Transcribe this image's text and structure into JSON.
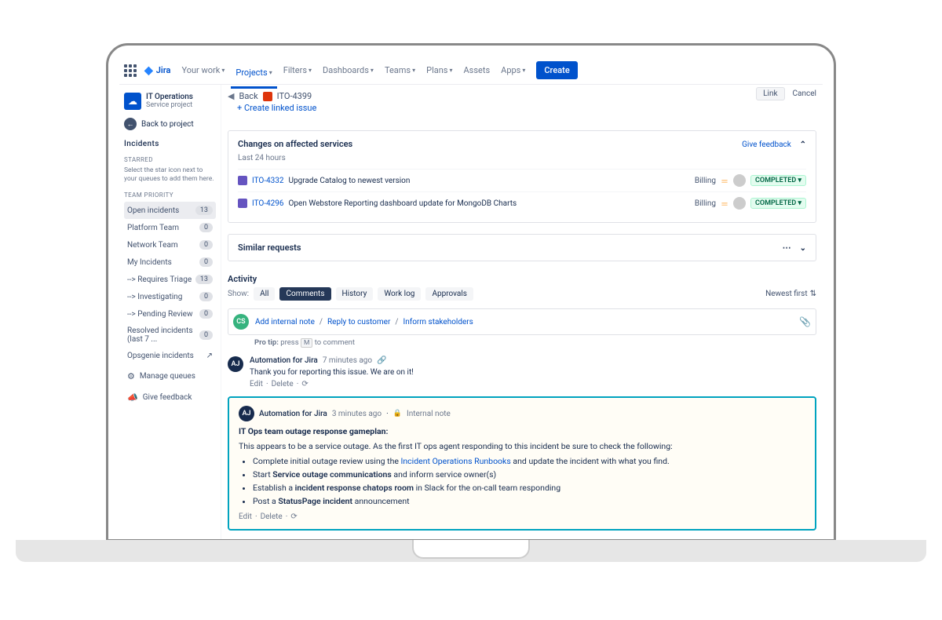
{
  "nav": {
    "product": "Jira",
    "items": [
      "Your work",
      "Projects",
      "Filters",
      "Dashboards",
      "Teams",
      "Plans",
      "Assets",
      "Apps"
    ],
    "create": "Create"
  },
  "sidebar": {
    "project_name": "IT Operations",
    "project_type": "Service project",
    "back": "Back to project",
    "incidents_header": "Incidents",
    "starred_header": "STARRED",
    "starred_hint": "Select the star icon next to your queues to add them here.",
    "team_header": "TEAM PRIORITY",
    "items": [
      {
        "label": "Open incidents",
        "count": "13",
        "sel": true
      },
      {
        "label": "Platform Team",
        "count": "0"
      },
      {
        "label": "Network Team",
        "count": "0"
      },
      {
        "label": "My Incidents",
        "count": "0"
      },
      {
        "label": "--> Requires Triage",
        "count": "13"
      },
      {
        "label": "--> Investigating",
        "count": "0"
      },
      {
        "label": "--> Pending Review",
        "count": "0"
      },
      {
        "label": "Resolved incidents (last 7 ...",
        "count": "0"
      },
      {
        "label": "Opsgenie incidents",
        "ext": true
      }
    ],
    "manage": "Manage queues",
    "feedback": "Give feedback"
  },
  "crumb": {
    "back": "Back",
    "issue": "ITO-4399",
    "create_linked": "+ Create linked issue",
    "link_btn": "Link",
    "cancel": "Cancel"
  },
  "changes": {
    "title": "Changes on affected services",
    "feedback": "Give feedback",
    "sub": "Last 24 hours",
    "rows": [
      {
        "key": "ITO-4332",
        "title": "Upgrade Catalog to newest version",
        "category": "Billing",
        "status": "COMPLETED"
      },
      {
        "key": "ITO-4296",
        "title": "Open Webstore Reporting dashboard update for MongoDB Charts",
        "category": "Billing",
        "status": "COMPLETED"
      }
    ]
  },
  "similar": {
    "title": "Similar requests"
  },
  "activity": {
    "title": "Activity",
    "show": "Show:",
    "tabs": [
      "All",
      "Comments",
      "History",
      "Work log",
      "Approvals"
    ],
    "newest": "Newest first",
    "avatar_cs": "CS",
    "add_note": "Add internal note",
    "reply": "Reply to customer",
    "inform": "Inform stakeholders",
    "protip_pre": "Pro tip:",
    "protip_post": "press",
    "protip_key": "M",
    "protip_end": "to comment",
    "c1": {
      "author": "Automation for Jira",
      "time": "7 minutes ago",
      "text": "Thank you for reporting this issue. We are on it!",
      "edit": "Edit",
      "delete": "Delete"
    },
    "c2": {
      "author": "Automation for Jira",
      "time": "3 minutes ago",
      "badge": "Internal note",
      "title": "IT Ops team outage response gameplan:",
      "intro": "This appears to be a service outage. As the first IT ops agent responding to this incident be sure to check the following:",
      "b1_a": "Complete initial outage review using the ",
      "b1_link": "Incident Operations Runbooks",
      "b1_b": " and update the incident with what you find.",
      "b2_a": "Start ",
      "b2_bold": "Service outage communications",
      "b2_b": " and inform service owner(s)",
      "b3_a": "Establish a ",
      "b3_bold": "incident response chatops room",
      "b3_b": " in Slack for the on-call team responding",
      "b4_a": "Post a ",
      "b4_bold": "StatusPage incident",
      "b4_b": " announcement",
      "edit": "Edit",
      "delete": "Delete"
    }
  }
}
